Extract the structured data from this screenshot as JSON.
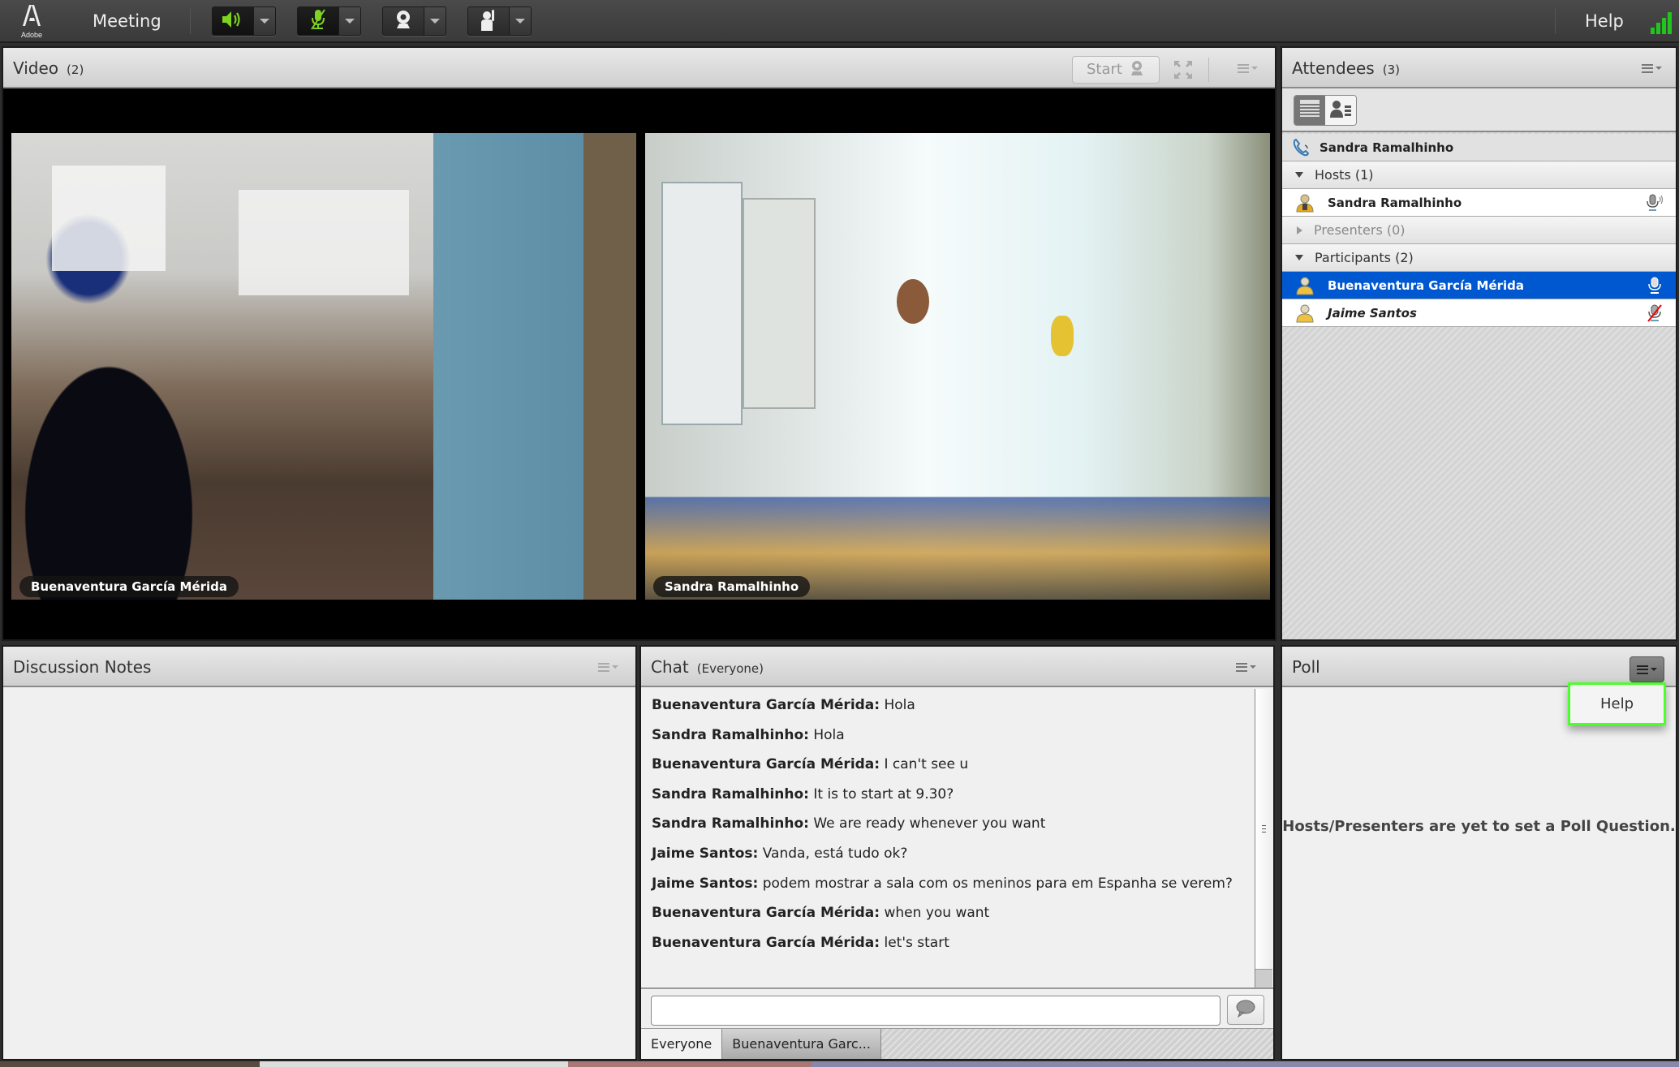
{
  "app": {
    "logo_text": "Adobe",
    "menu_meeting": "Meeting",
    "help": "Help",
    "toolbar": {
      "speaker": {
        "icon": "speaker-icon",
        "state": "on"
      },
      "microphone": {
        "icon": "microphone-muted-icon",
        "state": "muted"
      },
      "camera": {
        "icon": "webcam-icon",
        "state": "off"
      },
      "raise_hand": {
        "icon": "raise-hand-icon",
        "state": "off"
      }
    },
    "connection_signal": {
      "icon": "signal-strength-icon",
      "bars": 4,
      "max_bars": 4
    },
    "accent_color": "#0058d1",
    "signal_color": "#22c41e",
    "active_icon_color": "#7ed321"
  },
  "video": {
    "title": "Video",
    "count": "(2)",
    "start_button": "Start",
    "tiles": [
      {
        "name": "Buenaventura García Mérida"
      },
      {
        "name": "Sandra Ramalhinho"
      }
    ]
  },
  "attendees": {
    "title": "Attendees",
    "count": "(3)",
    "me": {
      "name": "Sandra Ramalhinho",
      "icon": "phone-icon"
    },
    "groups": [
      {
        "label": "Hosts (1)",
        "expanded": true,
        "members": [
          {
            "name": "Sandra Ramalhinho",
            "role_icon": "host-icon",
            "mic": "speaking"
          }
        ]
      },
      {
        "label": "Presenters (0)",
        "expanded": false,
        "members": []
      },
      {
        "label": "Participants (2)",
        "expanded": true,
        "members": [
          {
            "name": "Buenaventura García Mérida",
            "role_icon": "participant-icon",
            "mic": "on",
            "selected": true
          },
          {
            "name": "Jaime Santos",
            "role_icon": "participant-icon",
            "mic": "muted",
            "italic": true
          }
        ]
      }
    ]
  },
  "notes": {
    "title": "Discussion Notes"
  },
  "chat": {
    "title": "Chat",
    "scope": "(Everyone)",
    "messages": [
      {
        "who": "Buenaventura García Mérida:",
        "text": " Hola"
      },
      {
        "who": "Sandra Ramalhinho:",
        "text": " Hola"
      },
      {
        "who": "Buenaventura García Mérida:",
        "text": " I can't see u"
      },
      {
        "who": "Sandra Ramalhinho:",
        "text": " It is to start at 9.30?"
      },
      {
        "who": "Sandra Ramalhinho:",
        "text": " We are ready whenever you want"
      },
      {
        "who": "Jaime Santos:",
        "text": " Vanda, está tudo ok?"
      },
      {
        "who": "Jaime Santos:",
        "text": " podem mostrar a sala com os meninos para em Espanha se verem?"
      },
      {
        "who": "Buenaventura García Mérida:",
        "text": " when you want"
      },
      {
        "who": "Buenaventura García Mérida:",
        "text": " let's start"
      }
    ],
    "input_value": "",
    "input_placeholder": "",
    "tabs": [
      {
        "label": "Everyone",
        "active": true
      },
      {
        "label": "Buenaventura Garc...",
        "active": false
      }
    ]
  },
  "poll": {
    "title": "Poll",
    "menu_items": [
      "Help"
    ],
    "empty_message": "Hosts/Presenters are yet to set a Poll Question."
  }
}
